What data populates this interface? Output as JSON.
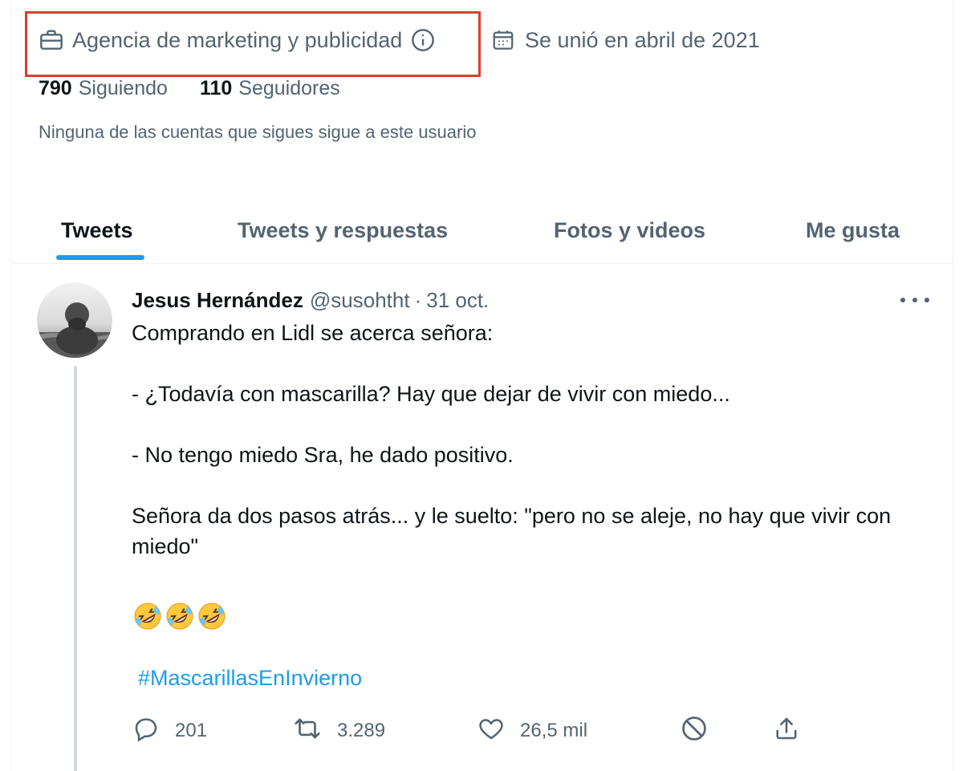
{
  "profile": {
    "category": "Agencia de marketing y publicidad",
    "joined": "Se unió en abril de 2021",
    "following_count": "790",
    "following_label": "Siguiendo",
    "followers_count": "110",
    "followers_label": "Seguidores",
    "followers_note": "Ninguna de las cuentas que sigues sigue a este usuario"
  },
  "tabs": [
    {
      "label": "Tweets",
      "active": true
    },
    {
      "label": "Tweets y respuestas",
      "active": false
    },
    {
      "label": "Fotos y videos",
      "active": false
    },
    {
      "label": "Me gusta",
      "active": false
    }
  ],
  "tweet": {
    "author": "Jesus Hernández",
    "handle": "@susohtht",
    "separator": "·",
    "date": "31 oct.",
    "lines": [
      "Comprando en Lidl se acerca señora:",
      "",
      "- ¿Todavía con mascarilla? Hay que dejar de vivir con miedo...",
      "",
      "- No tengo miedo Sra, he dado positivo.",
      "",
      "Señora da dos pasos atrás... y le suelto: \"pero no se aleje, no hay que vivir con miedo\""
    ],
    "emoji_count": 3,
    "hashtag": "#MascarillasEnInvierno",
    "replies": "201",
    "retweets": "3.289",
    "likes": "26,5 mil"
  },
  "colors": {
    "accent": "#1d9bf0",
    "muted_text": "#536471",
    "highlight_box": "#e03c2a"
  },
  "icons": [
    "briefcase-icon",
    "info-icon",
    "calendar-icon",
    "more-icon",
    "reply-icon",
    "retweet-icon",
    "like-icon",
    "block-icon",
    "share-icon"
  ]
}
